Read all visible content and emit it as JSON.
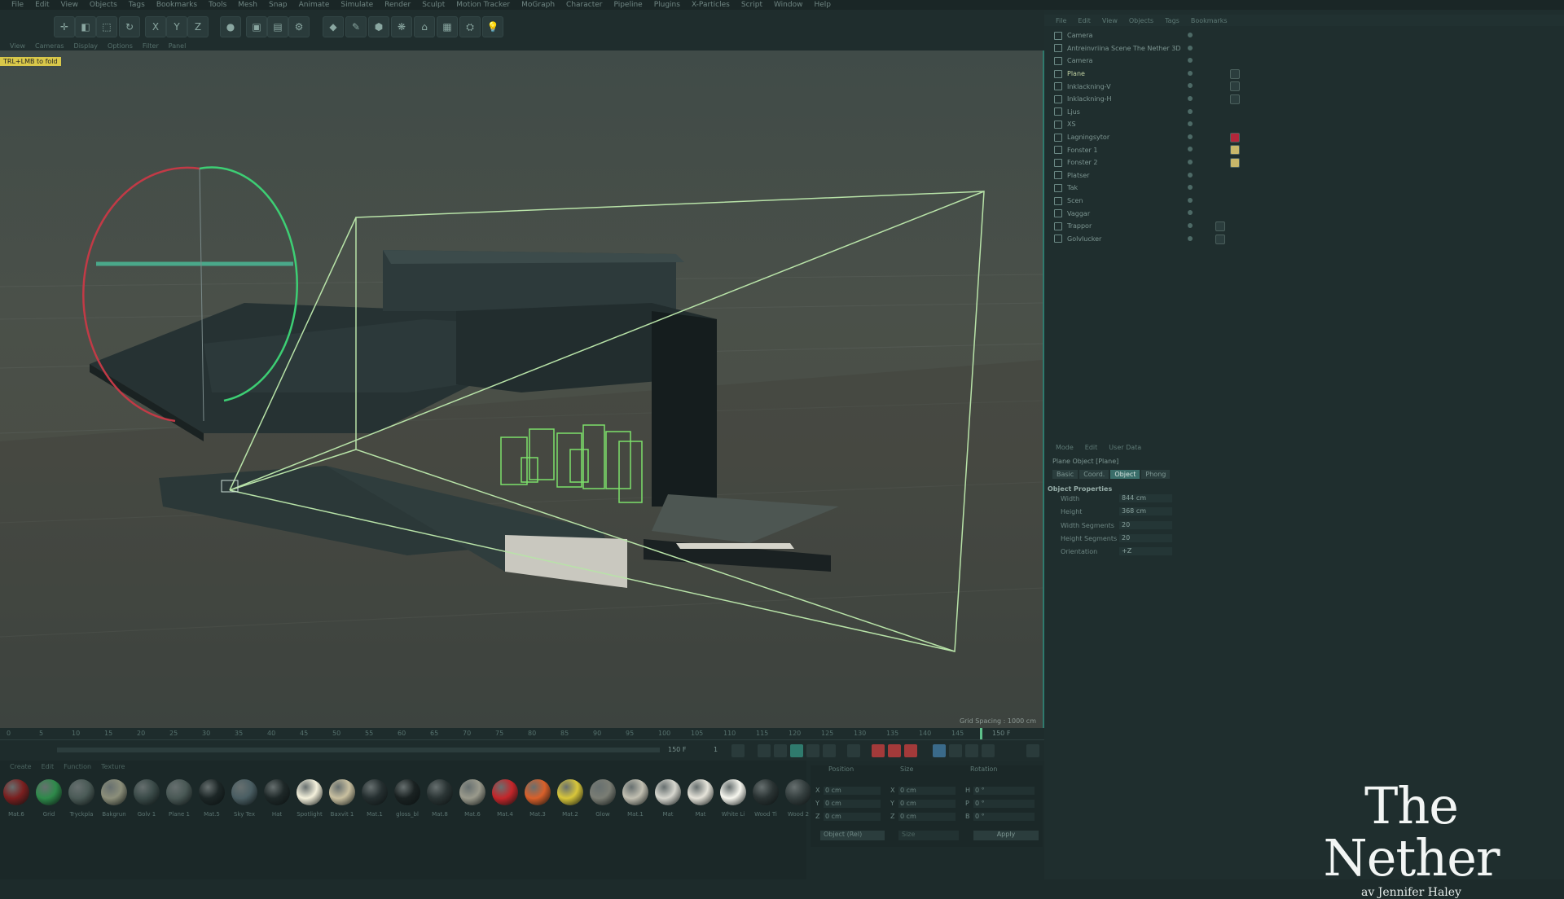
{
  "menubar": {
    "items": [
      "File",
      "Edit",
      "View",
      "Objects",
      "Tags",
      "Bookmarks",
      "Tools",
      "Mesh",
      "Snap",
      "Animate",
      "Simulate",
      "Render",
      "Sculpt",
      "Motion Tracker",
      "MoGraph",
      "Character",
      "Pipeline",
      "Plugins",
      "X-Particles",
      "Script",
      "Window",
      "Help"
    ]
  },
  "toolbar": {
    "sub_items": [
      "View",
      "Cameras",
      "Display",
      "Options",
      "Filter",
      "Panel"
    ]
  },
  "viewport": {
    "hint": "TRL+LMB to fold",
    "grid_spacing": "Grid Spacing : 1000 cm"
  },
  "timeline": {
    "ticks": [
      "0",
      "5",
      "10",
      "15",
      "20",
      "25",
      "30",
      "35",
      "40",
      "45",
      "50",
      "55",
      "60",
      "65",
      "70",
      "75",
      "80",
      "85",
      "90",
      "95",
      "100",
      "105",
      "110",
      "115",
      "120",
      "125",
      "130",
      "135",
      "140",
      "145"
    ],
    "end_frame": "150 F",
    "current_frame": "150 F",
    "frame_field": "1"
  },
  "materials": {
    "tabs": [
      "Create",
      "Edit",
      "Function",
      "Texture"
    ],
    "items": [
      {
        "label": "Mat.6",
        "color": "#7a1f1f"
      },
      {
        "label": "Grid",
        "color": "#2e8a4a"
      },
      {
        "label": "Tryckpla",
        "color": "#4a5a56"
      },
      {
        "label": "Bakgrun",
        "color": "#8c8f7a"
      },
      {
        "label": "Golv 1",
        "color": "#3a4a48"
      },
      {
        "label": "Plane 1",
        "color": "#495855"
      },
      {
        "label": "Mat.5",
        "color": "#1c2626"
      },
      {
        "label": "Sky Tex",
        "color": "#4a5e63"
      },
      {
        "label": "Hat",
        "color": "#1e2828"
      },
      {
        "label": "Spotlight",
        "color": "#f4f1dc"
      },
      {
        "label": "Baxvit 1",
        "color": "#c9c0a0"
      },
      {
        "label": "Mat.1",
        "color": "#252f30"
      },
      {
        "label": "gloss_bl",
        "color": "#1a2222"
      },
      {
        "label": "Mat.8",
        "color": "#2a3434"
      },
      {
        "label": "Mat.6",
        "color": "#9a9a8c"
      },
      {
        "label": "Mat.4",
        "color": "#c4262a"
      },
      {
        "label": "Mat.3",
        "color": "#d9602a"
      },
      {
        "label": "Mat.2",
        "color": "#d8c63a"
      },
      {
        "label": "Glow",
        "color": "#7a7d74"
      },
      {
        "label": "Mat.1",
        "color": "#c2c0b2"
      },
      {
        "label": "Mat",
        "color": "#d7d7cf"
      },
      {
        "label": "Mat",
        "color": "#e6e4da"
      },
      {
        "label": "White Li",
        "color": "#f7f7ef"
      },
      {
        "label": "Wood Ti",
        "color": "#2a3333"
      },
      {
        "label": "Wood 2",
        "color": "#343e3e"
      }
    ]
  },
  "coordinates": {
    "headers": [
      "Position",
      "Size",
      "Rotation"
    ],
    "rows": [
      {
        "axis": "X",
        "pos": "0 cm",
        "size_axis": "X",
        "size": "0 cm",
        "rot_axis": "H",
        "rot": "0 °"
      },
      {
        "axis": "Y",
        "pos": "0 cm",
        "size_axis": "Y",
        "size": "0 cm",
        "rot_axis": "P",
        "rot": "0 °"
      },
      {
        "axis": "Z",
        "pos": "0 cm",
        "size_axis": "Z",
        "size": "0 cm",
        "rot_axis": "B",
        "rot": "0 °"
      }
    ],
    "mode": "Object (Rel)",
    "size_mode": "Size",
    "apply": "Apply"
  },
  "object_manager": {
    "menu": [
      "File",
      "Edit",
      "View",
      "Objects",
      "Tags",
      "Bookmarks"
    ],
    "objects": [
      {
        "name": "Camera",
        "selected": false
      },
      {
        "name": "Antreinvriina Scene The Nether 3D",
        "selected": false
      },
      {
        "name": "Camera",
        "selected": false
      },
      {
        "name": "Plane",
        "selected": true
      },
      {
        "name": "Inklackning-V",
        "selected": false
      },
      {
        "name": "Inklackning-H",
        "selected": false
      },
      {
        "name": "Ljus",
        "selected": false
      },
      {
        "name": "XS",
        "selected": false
      },
      {
        "name": "Lagningsytor",
        "selected": false
      },
      {
        "name": "Fonster 1",
        "selected": false
      },
      {
        "name": "Fonster 2",
        "selected": false
      },
      {
        "name": "Platser",
        "selected": false
      },
      {
        "name": "Tak",
        "selected": false
      },
      {
        "name": "Scen",
        "selected": false
      },
      {
        "name": "Vaggar",
        "selected": false
      },
      {
        "name": "Trappor",
        "selected": false
      },
      {
        "name": "Golvlucker",
        "selected": false
      }
    ]
  },
  "attributes": {
    "menu": [
      "Mode",
      "Edit",
      "User Data"
    ],
    "title": "Plane Object [Plane]",
    "tabs": [
      "Basic",
      "Coord.",
      "Object",
      "Phong"
    ],
    "active_tab": "Object",
    "section": "Object Properties",
    "props": [
      {
        "label": "Width",
        "value": "844 cm"
      },
      {
        "label": "Height",
        "value": "368 cm"
      },
      {
        "label": "Width Segments",
        "value": "20"
      },
      {
        "label": "Height Segments",
        "value": "20"
      },
      {
        "label": "Orientation",
        "value": "+Z"
      }
    ]
  },
  "overlay": {
    "title": "The Nether",
    "subtitle": "av Jennifer Haley"
  },
  "colors": {
    "accent": "#2f7a6d",
    "selection": "#9ee07a",
    "gizmo_red": "#c23a46",
    "gizmo_green": "#3dcf74"
  }
}
